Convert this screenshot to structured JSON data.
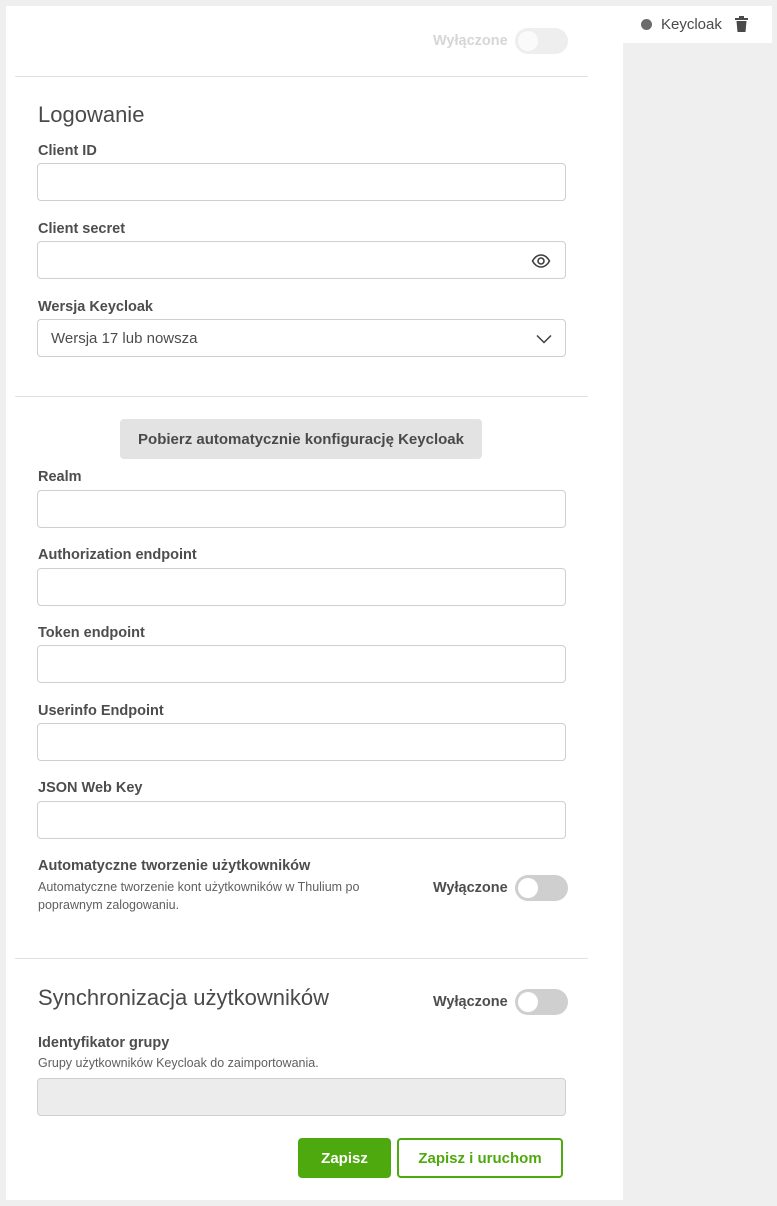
{
  "tab": {
    "title": "Keycloak",
    "status_icon": "status-dot-icon",
    "delete_icon": "trash-icon"
  },
  "top_toggle": {
    "label": "Wyłączone",
    "state": "off"
  },
  "login_section": {
    "title": "Logowanie",
    "client_id": {
      "label": "Client ID",
      "value": ""
    },
    "client_secret": {
      "label": "Client secret",
      "value": "",
      "icon": "eye-icon"
    },
    "version": {
      "label": "Wersja Keycloak",
      "selected": "Wersja 17 lub nowsza",
      "icon": "chevron-down-icon"
    }
  },
  "auto_config": {
    "button_label": "Pobierz automatycznie konfigurację Keycloak"
  },
  "fields": {
    "realm": {
      "label": "Realm",
      "value": ""
    },
    "authorization_endpoint": {
      "label": "Authorization endpoint",
      "value": ""
    },
    "token_endpoint": {
      "label": "Token endpoint",
      "value": ""
    },
    "userinfo_endpoint": {
      "label": "Userinfo Endpoint",
      "value": ""
    },
    "json_web_key": {
      "label": "JSON Web Key",
      "value": ""
    }
  },
  "auto_create": {
    "label": "Automatyczne tworzenie użytkowników",
    "description": "Automatyczne tworzenie kont użytkowników w Thulium po poprawnym zalogowaniu.",
    "toggle_label": "Wyłączone",
    "state": "off"
  },
  "sync_section": {
    "title": "Synchronizacja użytkowników",
    "toggle_label": "Wyłączone",
    "state": "off",
    "group_id": {
      "label": "Identyfikator grupy",
      "description": "Grupy użytkowników Keycloak do zaimportowania.",
      "value": ""
    }
  },
  "actions": {
    "save": "Zapisz",
    "save_and_run": "Zapisz i uruchom"
  },
  "colors": {
    "accent": "#4ea90f",
    "toggle_off": "#cfcfcf",
    "disabled_input": "#ececec"
  }
}
